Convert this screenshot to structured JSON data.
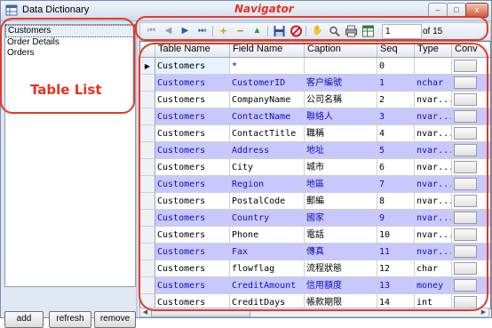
{
  "window": {
    "title": "Data Dictionary",
    "controls": {
      "minimize": "–",
      "maximize": "□",
      "close": "x"
    }
  },
  "annotations": {
    "navigator": "Navigator",
    "table_list": "Table List"
  },
  "table_list": {
    "items": [
      "Customers",
      "Order Details",
      "Orders"
    ],
    "selected_index": 0
  },
  "left_buttons": {
    "add": "add",
    "refresh": "refresh",
    "remove": "remove"
  },
  "navigator": {
    "position": "1",
    "of_label": "of 15",
    "icons": [
      "first-icon",
      "prev-icon",
      "next-icon",
      "last-icon",
      "add-new-icon",
      "delete-icon",
      "move-up-icon",
      "save-icon",
      "cancel-icon",
      "move-icon",
      "search-icon",
      "print-icon",
      "export-icon"
    ]
  },
  "grid": {
    "columns": [
      "Table Name",
      "Field Name",
      "Caption",
      "Seq",
      "Type",
      "Conv"
    ],
    "rows": [
      {
        "table": "Customers",
        "field": "*",
        "caption": "",
        "seq": "0",
        "type": ""
      },
      {
        "table": "Customers",
        "field": "CustomerID",
        "caption": "客户編號",
        "seq": "1",
        "type": "nchar"
      },
      {
        "table": "Customers",
        "field": "CompanyName",
        "caption": "公司名稱",
        "seq": "2",
        "type": "nvar..."
      },
      {
        "table": "Customers",
        "field": "ContactName",
        "caption": "聯絡人",
        "seq": "3",
        "type": "nvar..."
      },
      {
        "table": "Customers",
        "field": "ContactTitle",
        "caption": "職稱",
        "seq": "4",
        "type": "nvar..."
      },
      {
        "table": "Customers",
        "field": "Address",
        "caption": "地址",
        "seq": "5",
        "type": "nvar..."
      },
      {
        "table": "Customers",
        "field": "City",
        "caption": "城市",
        "seq": "6",
        "type": "nvar..."
      },
      {
        "table": "Customers",
        "field": "Region",
        "caption": "地區",
        "seq": "7",
        "type": "nvar..."
      },
      {
        "table": "Customers",
        "field": "PostalCode",
        "caption": "郵編",
        "seq": "8",
        "type": "nvar..."
      },
      {
        "table": "Customers",
        "field": "Country",
        "caption": "國家",
        "seq": "9",
        "type": "nvar..."
      },
      {
        "table": "Customers",
        "field": "Phone",
        "caption": "電話",
        "seq": "10",
        "type": "nvar..."
      },
      {
        "table": "Customers",
        "field": "Fax",
        "caption": "傳真",
        "seq": "11",
        "type": "nvar..."
      },
      {
        "table": "Customers",
        "field": "flowflag",
        "caption": "流程狀態",
        "seq": "12",
        "type": "char"
      },
      {
        "table": "Customers",
        "field": "CreditAmount",
        "caption": "信用額度",
        "seq": "13",
        "type": "money"
      },
      {
        "table": "Customers",
        "field": "CreditDays",
        "caption": "帳款期限",
        "seq": "14",
        "type": "int"
      }
    ]
  },
  "colors": {
    "annotation_red": "#e23a2a",
    "alt_row_bg": "#c8c8ff",
    "alt_row_text": "#1010b8"
  }
}
